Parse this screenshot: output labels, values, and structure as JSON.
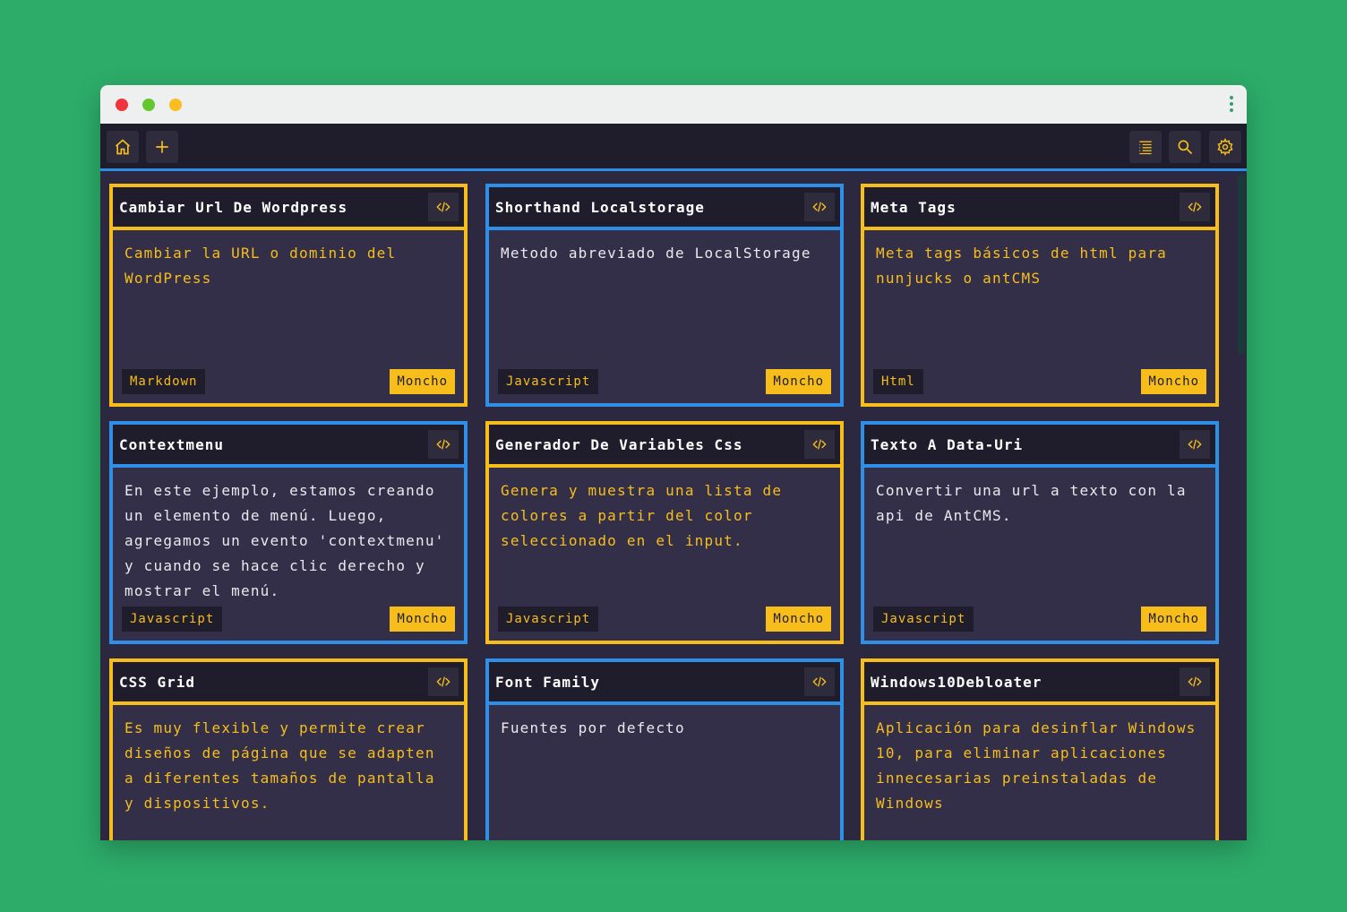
{
  "toolbar": {
    "left_buttons": [
      "home-icon",
      "plus-icon"
    ],
    "right_buttons": [
      "list-icon",
      "search-icon",
      "gear-icon"
    ]
  },
  "colors": {
    "background": "#2dac69",
    "accent_yellow": "#f7be1b",
    "accent_blue": "#2f8fe6",
    "card_bg": "#332f48",
    "header_bg": "#1f1c2c"
  },
  "cards": [
    {
      "title": "Cambiar Url De Wordpress",
      "description": "Cambiar la URL o dominio del WordPress",
      "language": "Markdown",
      "author": "Moncho",
      "accent": "yellow"
    },
    {
      "title": "Shorthand Localstorage",
      "description": "Metodo abreviado de LocalStorage",
      "language": "Javascript",
      "author": "Moncho",
      "accent": "blue"
    },
    {
      "title": "Meta Tags",
      "description": "Meta tags básicos de html para nunjucks o antCMS",
      "language": "Html",
      "author": "Moncho",
      "accent": "yellow"
    },
    {
      "title": "Contextmenu",
      "description": "En este ejemplo, estamos creando un elemento de menú. Luego, agregamos un evento 'contextmenu' y cuando se hace clic derecho y mostrar el menú.",
      "language": "Javascript",
      "author": "Moncho",
      "accent": "blue"
    },
    {
      "title": "Generador De Variables Css",
      "description": "Genera y muestra una lista de colores a partir del color seleccionado en el input.",
      "language": "Javascript",
      "author": "Moncho",
      "accent": "yellow"
    },
    {
      "title": "Texto A Data-Uri",
      "description": "Convertir una url a texto con la api de AntCMS.",
      "language": "Javascript",
      "author": "Moncho",
      "accent": "blue"
    },
    {
      "title": "CSS Grid",
      "description": "Es muy flexible y permite crear diseños de página que se adapten a diferentes tamaños de pantalla y dispositivos.",
      "language": "",
      "author": "",
      "accent": "yellow"
    },
    {
      "title": "Font Family",
      "description": "Fuentes por defecto",
      "language": "",
      "author": "",
      "accent": "blue"
    },
    {
      "title": "Windows10Debloater",
      "description": "Aplicación para desinflar Windows 10, para eliminar aplicaciones innecesarias preinstaladas de Windows",
      "language": "",
      "author": "",
      "accent": "yellow"
    }
  ]
}
